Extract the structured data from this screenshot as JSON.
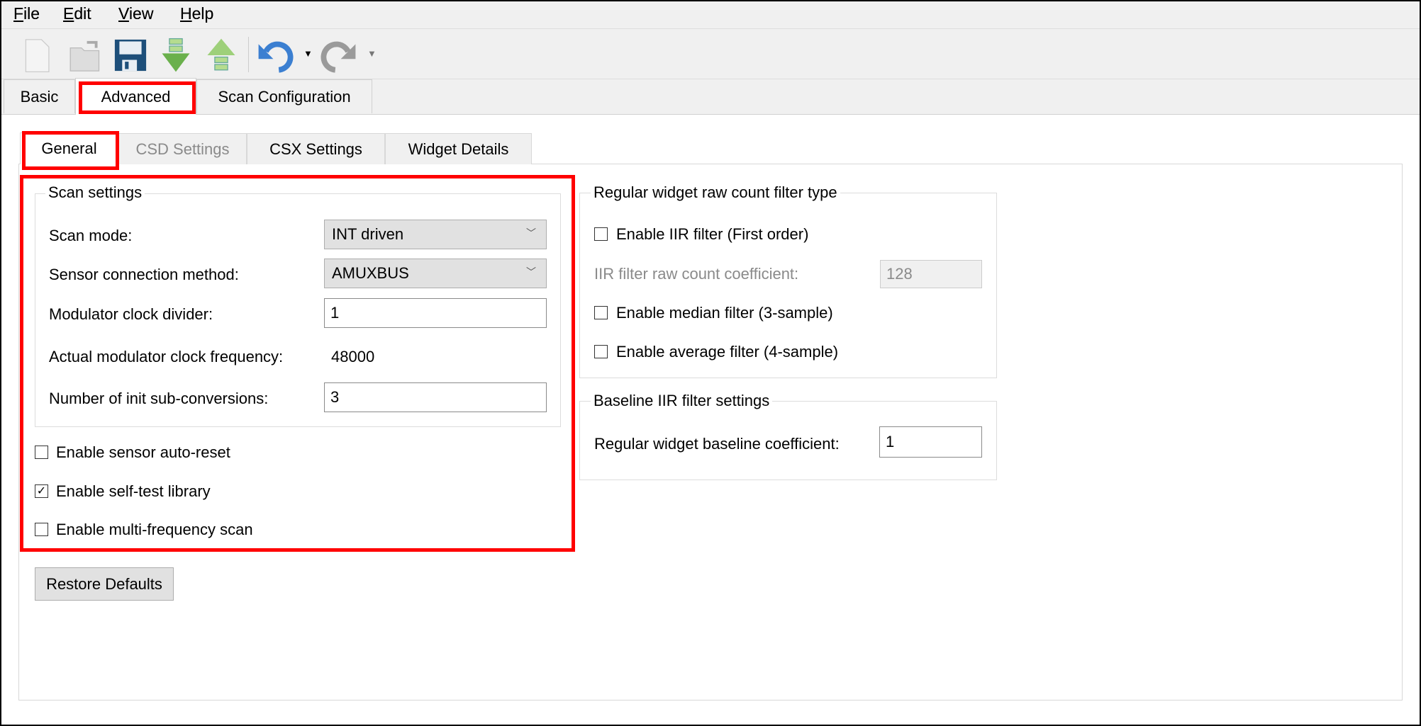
{
  "menu": {
    "items": [
      {
        "label": "File",
        "key": "F",
        "rest": "ile"
      },
      {
        "label": "Edit",
        "key": "E",
        "rest": "dit"
      },
      {
        "label": "View",
        "key": "V",
        "rest": "iew"
      },
      {
        "label": "Help",
        "key": "H",
        "rest": "elp"
      }
    ]
  },
  "toolbar": {
    "icons": [
      "new-document-icon",
      "open-folder-icon",
      "save-icon",
      "import-icon",
      "export-icon",
      "undo-icon",
      "redo-icon"
    ]
  },
  "main_tabs": [
    {
      "label": "Basic"
    },
    {
      "label": "Advanced",
      "selected": true
    },
    {
      "label": "Scan Configuration"
    }
  ],
  "sub_tabs": [
    {
      "label": "General",
      "selected": true
    },
    {
      "label": "CSD Settings",
      "disabled": true
    },
    {
      "label": "CSX Settings"
    },
    {
      "label": "Widget Details"
    }
  ],
  "scan_settings": {
    "title": "Scan settings",
    "scan_mode": {
      "label": "Scan mode:",
      "value": "INT driven"
    },
    "sensor_connection": {
      "label": "Sensor connection method:",
      "value": "AMUXBUS"
    },
    "mod_clk_divider": {
      "label": "Modulator clock divider:",
      "value": "1"
    },
    "actual_freq": {
      "label": "Actual modulator clock frequency:",
      "value": "48000"
    },
    "init_sub_conv": {
      "label": "Number of init sub-conversions:",
      "value": "3"
    }
  },
  "options": [
    {
      "label": "Enable sensor auto-reset",
      "checked": false
    },
    {
      "label": "Enable self-test library",
      "checked": true
    },
    {
      "label": "Enable multi-frequency scan",
      "checked": false
    }
  ],
  "restore_defaults": "Restore Defaults",
  "raw_filter": {
    "title": "Regular widget raw count filter type",
    "iir": {
      "label": "Enable IIR filter (First order)",
      "checked": false
    },
    "iir_coeff": {
      "label": "IIR filter raw count coefficient:",
      "value": "128",
      "disabled": true
    },
    "median": {
      "label": "Enable median filter (3-sample)",
      "checked": false
    },
    "average": {
      "label": "Enable average filter (4-sample)",
      "checked": false
    }
  },
  "baseline": {
    "title": "Baseline IIR filter settings",
    "coeff": {
      "label": "Regular widget baseline coefficient:",
      "value": "1"
    }
  },
  "highlight_color": "#ff0000"
}
